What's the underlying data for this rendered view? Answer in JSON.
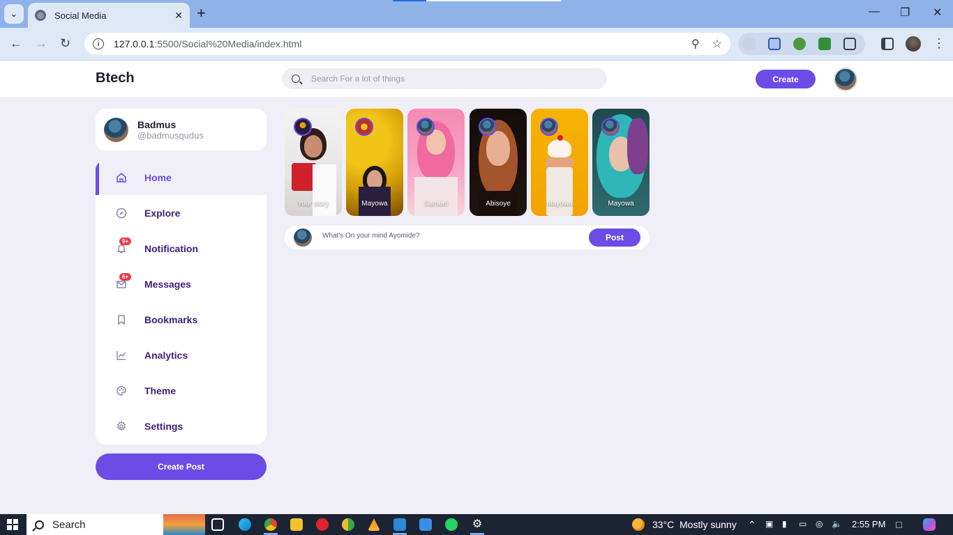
{
  "browser": {
    "tab_title": "Social Media",
    "url_host": "127.0.0.1",
    "url_rest": ":5500/Social%20Media/index.html"
  },
  "app": {
    "logo": "Btech",
    "search_placeholder": "Search For a lot of things",
    "create_label": "Create",
    "accent_color": "#6b4ce6"
  },
  "profile": {
    "name": "Badmus",
    "handle": "@badmusqudus"
  },
  "menu": [
    {
      "label": "Home",
      "icon": "home-icon",
      "active": true
    },
    {
      "label": "Explore",
      "icon": "compass-icon"
    },
    {
      "label": "Notification",
      "icon": "bell-icon",
      "badge": "9+"
    },
    {
      "label": "Messages",
      "icon": "envelope-icon",
      "badge": "6+"
    },
    {
      "label": "Bookmarks",
      "icon": "bookmark-icon"
    },
    {
      "label": "Analytics",
      "icon": "chart-icon"
    },
    {
      "label": "Theme",
      "icon": "palette-icon"
    },
    {
      "label": "Settings",
      "icon": "gear-icon"
    }
  ],
  "create_post_label": "Create Post",
  "stories": [
    {
      "name": "Your story"
    },
    {
      "name": "Mayowa"
    },
    {
      "name": "Samuel"
    },
    {
      "name": "Abisoye"
    },
    {
      "name": "Mayowa"
    },
    {
      "name": "Mayowa"
    }
  ],
  "compose": {
    "placeholder": "What's On your mind Ayomide?",
    "post_label": "Post"
  },
  "taskbar": {
    "search_label": "Search",
    "weather_temp": "33°C",
    "weather_desc": "Mostly sunny",
    "time": "2:55 PM"
  }
}
